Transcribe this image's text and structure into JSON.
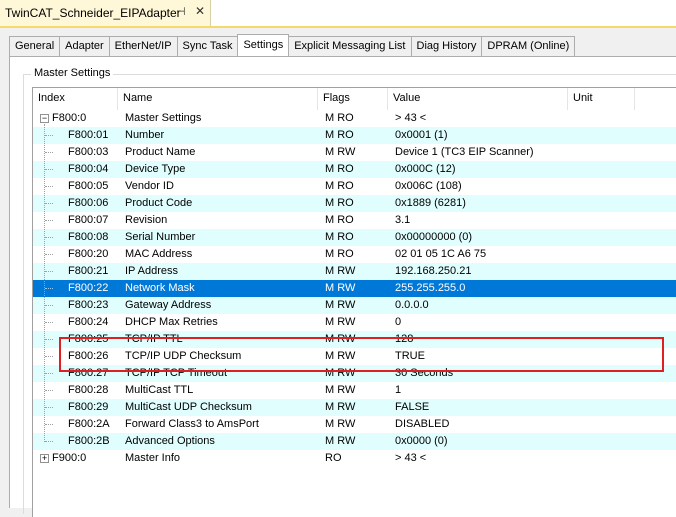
{
  "doc_tab": {
    "title": "TwinCAT_Schneider_EIPAdapter",
    "pin_icon": "pin-icon",
    "close_icon": "close-icon"
  },
  "tabs": [
    {
      "label": "General"
    },
    {
      "label": "Adapter"
    },
    {
      "label": "EtherNet/IP"
    },
    {
      "label": "Sync Task"
    },
    {
      "label": "Settings",
      "active": true
    },
    {
      "label": "Explicit Messaging List"
    },
    {
      "label": "Diag History"
    },
    {
      "label": "DPRAM (Online)"
    }
  ],
  "group_title": "Master Settings",
  "columns": {
    "index": "Index",
    "name": "Name",
    "flags": "Flags",
    "value": "Value",
    "unit": "Unit"
  },
  "rows": [
    {
      "index": "F800:0",
      "name": "Master Settings",
      "flags": "M RO",
      "value": "> 43 <",
      "level": 0,
      "expander": "−"
    },
    {
      "index": "F800:01",
      "name": "Number",
      "flags": "M RO",
      "value": "0x0001 (1)",
      "level": 1
    },
    {
      "index": "F800:03",
      "name": "Product Name",
      "flags": "M RW",
      "value": "Device 1 (TC3 EIP Scanner)",
      "level": 1
    },
    {
      "index": "F800:04",
      "name": "Device Type",
      "flags": "M RO",
      "value": "0x000C (12)",
      "level": 1
    },
    {
      "index": "F800:05",
      "name": "Vendor ID",
      "flags": "M RO",
      "value": "0x006C (108)",
      "level": 1
    },
    {
      "index": "F800:06",
      "name": "Product Code",
      "flags": "M RO",
      "value": "0x1889 (6281)",
      "level": 1
    },
    {
      "index": "F800:07",
      "name": "Revision",
      "flags": "M RO",
      "value": "3.1",
      "level": 1
    },
    {
      "index": "F800:08",
      "name": "Serial Number",
      "flags": "M RO",
      "value": "0x00000000 (0)",
      "level": 1
    },
    {
      "index": "F800:20",
      "name": "MAC Address",
      "flags": "M RO",
      "value": "02 01 05 1C A6 75",
      "level": 1
    },
    {
      "index": "F800:21",
      "name": "IP Address",
      "flags": "M RW",
      "value": "192.168.250.21",
      "level": 1
    },
    {
      "index": "F800:22",
      "name": "Network Mask",
      "flags": "M RW",
      "value": "255.255.255.0",
      "level": 1,
      "selected": true
    },
    {
      "index": "F800:23",
      "name": "Gateway Address",
      "flags": "M RW",
      "value": "0.0.0.0",
      "level": 1
    },
    {
      "index": "F800:24",
      "name": "DHCP Max Retries",
      "flags": "M RW",
      "value": "0",
      "level": 1
    },
    {
      "index": "F800:25",
      "name": "TCP/IP TTL",
      "flags": "M RW",
      "value": "128",
      "level": 1
    },
    {
      "index": "F800:26",
      "name": "TCP/IP UDP Checksum",
      "flags": "M RW",
      "value": "TRUE",
      "level": 1
    },
    {
      "index": "F800:27",
      "name": "TCP/IP TCP Timeout",
      "flags": "M RW",
      "value": "30 Seconds",
      "level": 1
    },
    {
      "index": "F800:28",
      "name": "MultiCast TTL",
      "flags": "M RW",
      "value": "1",
      "level": 1
    },
    {
      "index": "F800:29",
      "name": "MultiCast UDP Checksum",
      "flags": "M RW",
      "value": "FALSE",
      "level": 1
    },
    {
      "index": "F800:2A",
      "name": "Forward Class3 to AmsPort",
      "flags": "M RW",
      "value": "DISABLED",
      "level": 1
    },
    {
      "index": "F800:2B",
      "name": "Advanced Options",
      "flags": "M RW",
      "value": "0x0000 (0)",
      "level": 1
    },
    {
      "index": "F900:0",
      "name": "Master Info",
      "flags": "RO",
      "value": "> 43 <",
      "level": 0,
      "expander": "+"
    }
  ],
  "colors": {
    "alt_row": "#e1fefe",
    "selected": "#0078d7",
    "highlight": "#e02020",
    "doc_tab": "#fff8d8"
  }
}
